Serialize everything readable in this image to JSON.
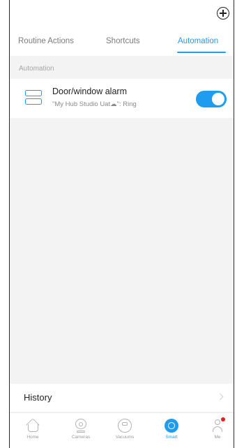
{
  "tabs": [
    {
      "label": "Routine Actions"
    },
    {
      "label": "Shortcuts"
    },
    {
      "label": "Automation"
    }
  ],
  "active_tab": "Automation",
  "section_label": "Automation",
  "automation_item": {
    "title": "Door/window alarm",
    "subtitle": "\"My Hub Studio Uat☁\": Ring",
    "enabled": true
  },
  "history": {
    "label": "History"
  },
  "bottom_nav": [
    {
      "label": "Home",
      "icon": "home-icon"
    },
    {
      "label": "Cameras",
      "icon": "camera-icon"
    },
    {
      "label": "Vacuums",
      "icon": "vacuum-icon"
    },
    {
      "label": "Smart",
      "icon": "smart-icon"
    },
    {
      "label": "Me",
      "icon": "profile-icon"
    }
  ],
  "active_nav": "Smart",
  "colors": {
    "accent": "#1e9cef",
    "badge": "#e02020",
    "background": "#f3f3f3"
  }
}
